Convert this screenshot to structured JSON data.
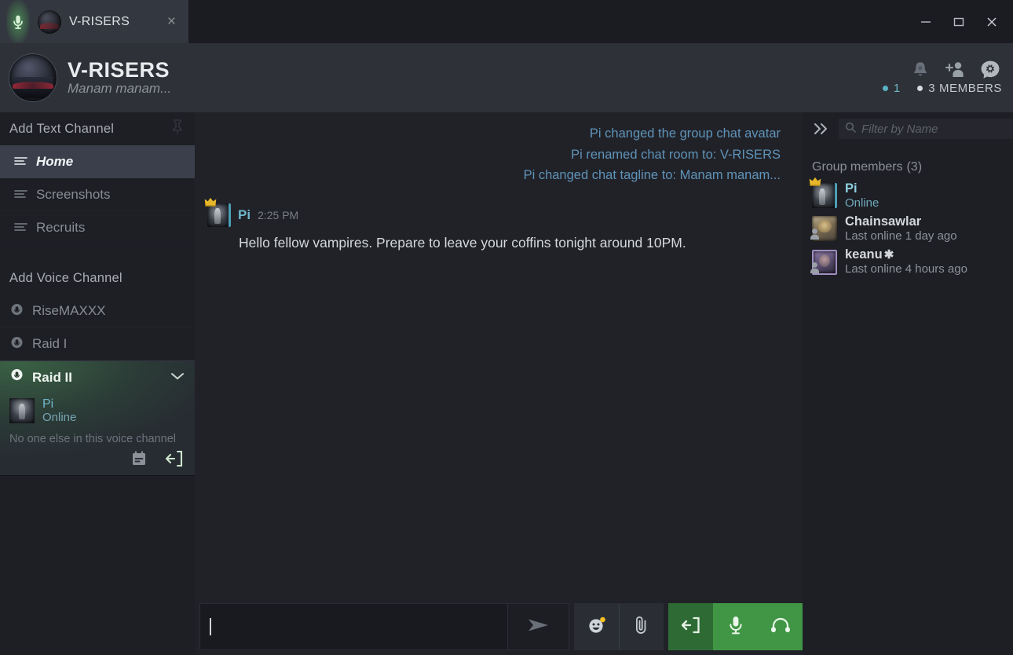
{
  "window": {
    "tab_title": "V-RISERS",
    "tab_close_label": "×",
    "minimize_label": "minimize",
    "maximize_label": "maximize",
    "close_label": "close"
  },
  "group_header": {
    "title": "V-RISERS",
    "tagline": "Manam manam...",
    "online_count": "1",
    "members_count": "3 MEMBERS",
    "icons": [
      "bell-icon",
      "add-friend-icon",
      "chat-settings-icon"
    ]
  },
  "sidebar": {
    "text_section_label": "Add Text Channel",
    "voice_section_label": "Add Voice Channel",
    "text_channels": [
      {
        "label": "Home",
        "active": true
      },
      {
        "label": "Screenshots",
        "active": false
      },
      {
        "label": "Recruits",
        "active": false
      }
    ],
    "voice_channels": [
      {
        "label": "RiseMAXXX",
        "active": false
      },
      {
        "label": "Raid I",
        "active": false
      }
    ],
    "active_voice": {
      "label": "Raid II",
      "member_name": "Pi",
      "member_status": "Online",
      "empty_note": "No one else in this voice channel",
      "actions": [
        "notes-icon",
        "leave-voice-icon"
      ]
    }
  },
  "chat": {
    "system_messages": [
      "Pi changed the group chat avatar",
      "Pi renamed chat room to: V-RISERS",
      "Pi changed chat tagline to: Manam manam..."
    ],
    "messages": [
      {
        "author": "Pi",
        "time": "2:25 PM",
        "text": "Hello fellow vampires. Prepare to leave your coffins tonight around 10PM."
      }
    ]
  },
  "composer": {
    "input_value": "",
    "input_placeholder": "",
    "send_label": "send-icon",
    "emoji_label": "emoji-icon",
    "attach_label": "attachment-icon",
    "leave_voice_label": "leave-voice-icon",
    "mic_label": "microphone-icon",
    "headphones_label": "headphones-icon"
  },
  "right_panel": {
    "filter_placeholder": "Filter by Name",
    "filter_value": "",
    "members_title": "Group members",
    "members_count": "(3)",
    "members": [
      {
        "name": "Pi",
        "suffix": "",
        "status": "Online",
        "online": true,
        "owner": true
      },
      {
        "name": "Chainsawlar",
        "suffix": "",
        "status": "Last online 1 day ago",
        "online": false,
        "owner": false
      },
      {
        "name": "keanu",
        "suffix": "✱",
        "status": "Last online 4 hours ago",
        "online": false,
        "owner": false
      }
    ]
  },
  "colors": {
    "accent_green": "#409644",
    "accent_teal": "#6fb6cc",
    "system_blue": "#5f93b8",
    "chat_bg": "#212228",
    "sidebar_bg": "#1e1f25",
    "header_bg": "#2e3138",
    "active_channel_bg": "#3a3f4b"
  }
}
